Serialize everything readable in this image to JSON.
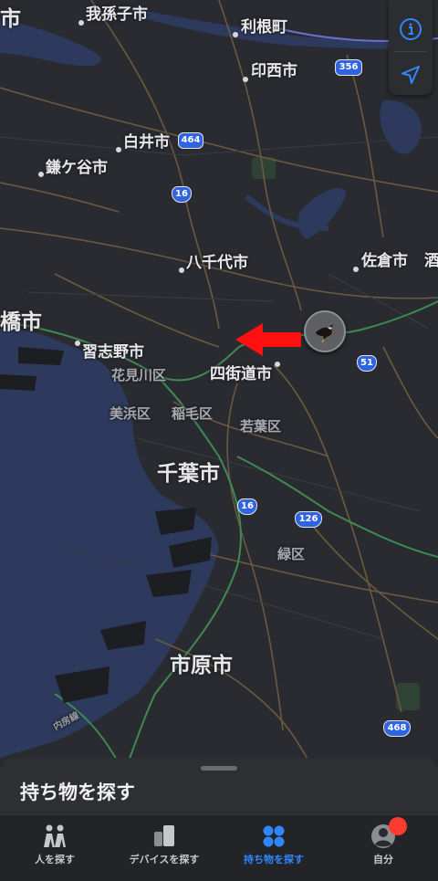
{
  "map": {
    "labels": {
      "ichi_edge": "市",
      "abiko": "我孫子市",
      "tone": "利根町",
      "inzai": "印西市",
      "shiroi": "白井市",
      "kamagaya": "鎌ケ谷市",
      "yachiyo": "八千代市",
      "sakura": "佐倉市",
      "sake_edge": "酒",
      "funabashi": "橋市",
      "narashino": "習志野市",
      "hanamigawa": "花見川区",
      "yotsukaido": "四街道市",
      "mihama": "美浜区",
      "inage": "稲毛区",
      "wakaba": "若葉区",
      "chiba": "千葉市",
      "midori": "緑区",
      "ichihara": "市原市",
      "uchibo": "内房線"
    },
    "routes": {
      "r356": "356",
      "r464": "464",
      "r16a": "16",
      "r51": "51",
      "r16b": "16",
      "r126": "126",
      "r468": "468"
    },
    "colors": {
      "water": "#2d3a5e",
      "land": "#2a2b30",
      "road": "#6b5a3e",
      "rail": "#3f8a53",
      "arrow": "#ff1010"
    }
  },
  "controls": {
    "info_icon": "info-circle-icon",
    "locate_icon": "location-arrow-icon"
  },
  "sheet": {
    "title": "持ち物を探す"
  },
  "tabs": [
    {
      "label": "人を探す",
      "icon": "people-icon"
    },
    {
      "label": "デバイスを探す",
      "icon": "devices-icon"
    },
    {
      "label": "持ち物を探す",
      "icon": "items-icon",
      "active": true
    },
    {
      "label": "自分",
      "icon": "person-circle-icon"
    }
  ]
}
